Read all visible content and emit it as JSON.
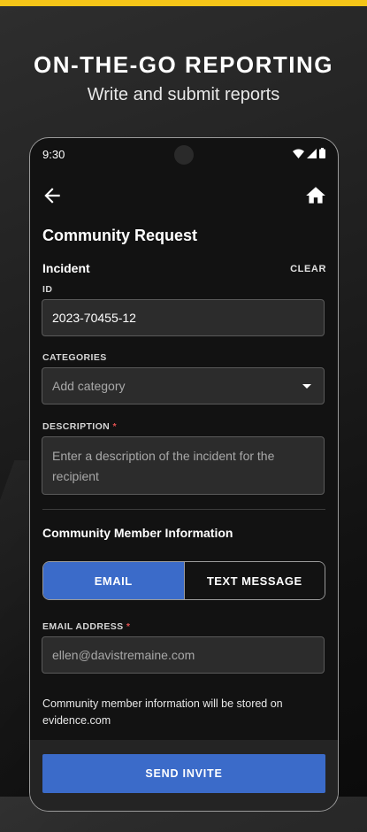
{
  "promo": {
    "headline": "ON-THE-GO REPORTING",
    "subheadline": "Write and submit reports"
  },
  "status_bar": {
    "time": "9:30",
    "icons": [
      "wifi-icon",
      "cellular-signal-icon",
      "battery-icon"
    ]
  },
  "app_bar": {
    "back_icon": "arrow-left-icon",
    "home_icon": "home-icon"
  },
  "form": {
    "title": "Community Request",
    "incident_section": "Incident",
    "clear_label": "CLEAR",
    "id_label": "ID",
    "id_value": "2023-70455-12",
    "categories_label": "CATEGORIES",
    "categories_placeholder": "Add category",
    "description_label": "DESCRIPTION",
    "required_marker": "*",
    "description_placeholder": "Enter a description of the incident for the recipient"
  },
  "community": {
    "title": "Community Member Information",
    "toggle": {
      "email_label": "EMAIL",
      "text_label": "TEXT MESSAGE",
      "selected": "EMAIL"
    },
    "email_label": "EMAIL ADDRESS",
    "email_placeholder": "ellen@davistremaine.com",
    "note": "Community member information will be stored on evidence.com",
    "send_label": "SEND INVITE"
  },
  "colors": {
    "accent_yellow": "#f5c518",
    "primary_blue": "#3b6bc9",
    "required_red": "#e05050"
  }
}
